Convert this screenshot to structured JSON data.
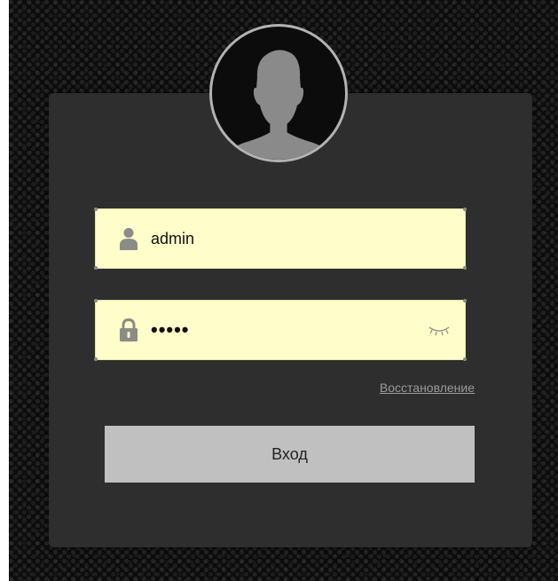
{
  "login_form": {
    "avatar_icon": "user-silhouette-icon",
    "username": {
      "icon": "user-icon",
      "value": "admin"
    },
    "password": {
      "icon": "lock-icon",
      "masked_value": "•••••",
      "toggle_icon": "eye-closed-icon"
    },
    "recover_label": "Восстановление",
    "submit_label": "Вход"
  },
  "colors": {
    "page_background": "#0c0c0c",
    "card_background": "#2e2e2e",
    "field_background": "#fffdc9",
    "button_background": "#c0c0c0",
    "avatar_ring": "#b2b2b2",
    "silhouette": "#8a8a8a"
  }
}
